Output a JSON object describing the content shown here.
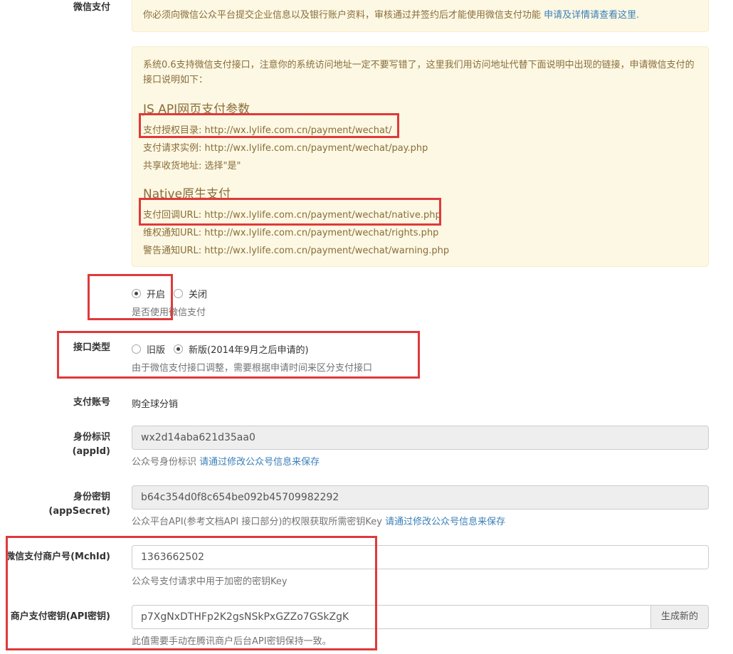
{
  "colors": {
    "highlight_box": "#e0393b",
    "alert_bg": "#fcf8e3",
    "alert_text": "#8a6d3b",
    "link": "#3a7fb8"
  },
  "wechat_pay": {
    "label": "微信支付",
    "notice_text": "你必须向微信公众平台提交企业信息以及银行账户资料，审核通过并签约后才能使用微信支付功能",
    "notice_link": "申请及详情请查看这里.",
    "info": {
      "intro": "系统0.6支持微信支付接口，注意你的系统访问地址一定不要写错了，这里我们用访问地址代替下面说明中出现的链接，申请微信支付的接口说明如下：",
      "jsapi_title": "JS API网页支付参数",
      "jsapi_lines": [
        "支付授权目录: http://wx.lylife.com.cn/payment/wechat/",
        "支付请求实例: http://wx.lylife.com.cn/payment/wechat/pay.php",
        "共享收货地址: 选择\"是\""
      ],
      "native_title": "Native原生支付",
      "native_lines": [
        "支付回调URL: http://wx.lylife.com.cn/payment/wechat/native.php",
        "维权通知URL: http://wx.lylife.com.cn/payment/wechat/rights.php",
        "警告通知URL: http://wx.lylife.com.cn/payment/wechat/warning.php"
      ]
    },
    "enable_options": [
      "开启",
      "关闭"
    ],
    "enable_selected": "开启",
    "enable_help": "是否使用微信支付"
  },
  "api_type": {
    "label": "接口类型",
    "options": [
      "旧版",
      "新版(2014年9月之后申请的)"
    ],
    "selected": "新版(2014年9月之后申请的)",
    "help": "由于微信支付接口调整，需要根据申请时间来区分支付接口"
  },
  "pay_account": {
    "label": "支付账号",
    "value": "购全球分销"
  },
  "appid": {
    "label_line1": "身份标识",
    "label_line2": "(appId)",
    "value": "wx2d14aba621d35aa0",
    "help": "公众号身份标识",
    "help_link": "请通过修改公众号信息来保存"
  },
  "appsecret": {
    "label_line1": "身份密钥",
    "label_line2": "(appSecret)",
    "value": "b64c354d0f8c654be092b45709982292",
    "help": "公众平台API(参考文档API 接口部分)的权限获取所需密钥Key",
    "help_link": "请通过修改公众号信息来保存"
  },
  "mchid": {
    "label": "微信支付商户号(MchId)",
    "value": "1363662502",
    "help": "公众号支付请求中用于加密的密钥Key"
  },
  "api_key": {
    "label": "商户支付密钥(API密钥)",
    "value": "p7XgNxDTHFp2K2gsNSkPxGZZo7GSkZgK",
    "button": "生成新的",
    "help": "此值需要手动在腾讯商户后台API密钥保持一致。"
  }
}
